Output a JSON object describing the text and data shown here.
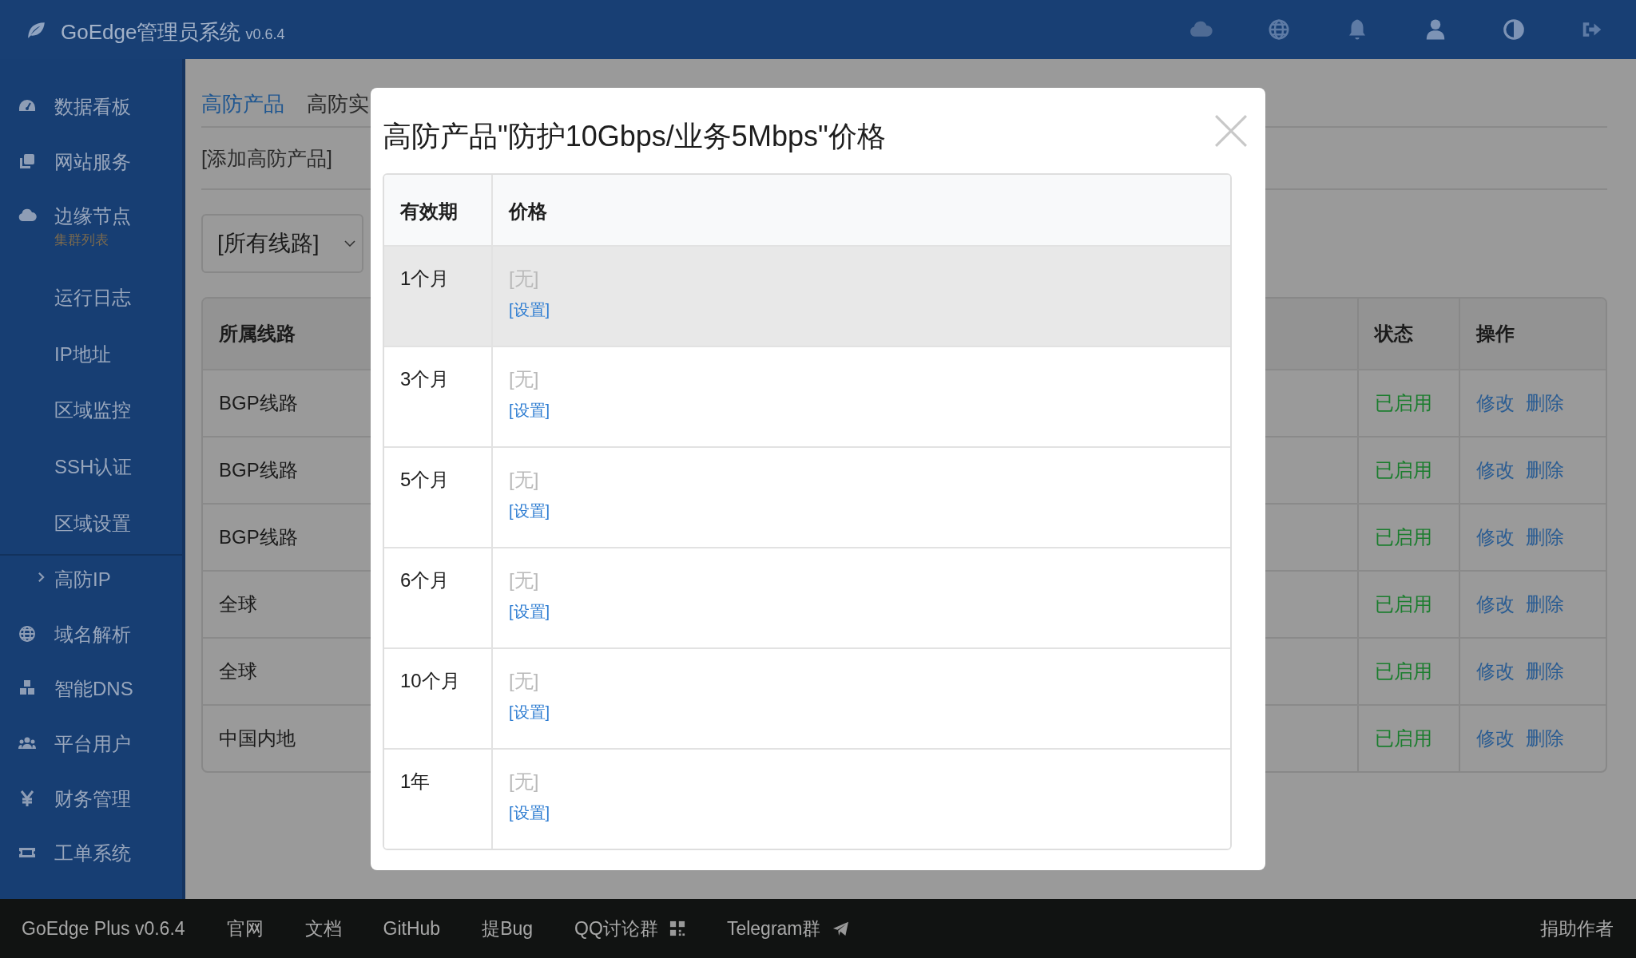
{
  "header": {
    "title": "GoEdge管理员系统",
    "version": "v0.6.4"
  },
  "sidebar": {
    "items": [
      {
        "kind": "main",
        "label": "数据看板"
      },
      {
        "kind": "main",
        "label": "网站服务"
      },
      {
        "kind": "main",
        "label": "边缘节点",
        "subtitle": "集群列表"
      },
      {
        "kind": "sub",
        "label": "运行日志"
      },
      {
        "kind": "sub",
        "label": "IP地址"
      },
      {
        "kind": "sub",
        "label": "区域监控"
      },
      {
        "kind": "sub",
        "label": "SSH认证"
      },
      {
        "kind": "sub",
        "label": "区域设置"
      },
      {
        "kind": "collapsible",
        "label": "高防IP"
      },
      {
        "kind": "main",
        "label": "域名解析"
      },
      {
        "kind": "main",
        "label": "智能DNS"
      },
      {
        "kind": "main",
        "label": "平台用户"
      },
      {
        "kind": "main",
        "label": "财务管理"
      },
      {
        "kind": "main",
        "label": "工单系统"
      }
    ]
  },
  "tabs": [
    {
      "label": "高防产品",
      "selected": true
    },
    {
      "label": "高防实",
      "selected": false
    }
  ],
  "add_link": "[添加高防产品]",
  "filter": {
    "value": "[所有线路]"
  },
  "table": {
    "columns": [
      "所属线路",
      "状态",
      "操作"
    ],
    "rows": [
      {
        "line": "BGP线路",
        "status": "已启用",
        "actions": [
          "修改",
          "删除"
        ]
      },
      {
        "line": "BGP线路",
        "status": "已启用",
        "actions": [
          "修改",
          "删除"
        ]
      },
      {
        "line": "BGP线路",
        "status": "已启用",
        "actions": [
          "修改",
          "删除"
        ]
      },
      {
        "line": "全球",
        "status": "已启用",
        "actions": [
          "修改",
          "删除"
        ]
      },
      {
        "line": "全球",
        "status": "已启用",
        "actions": [
          "修改",
          "删除"
        ]
      },
      {
        "line": "中国内地",
        "status": "已启用",
        "actions": [
          "修改",
          "删除"
        ]
      }
    ]
  },
  "modal": {
    "title": "高防产品\"防护10Gbps/业务5Mbps\"价格",
    "columns": [
      "有效期",
      "价格"
    ],
    "rows": [
      {
        "period": "1个月",
        "price": "[无]",
        "action": "[设置]",
        "hovered": true
      },
      {
        "period": "3个月",
        "price": "[无]",
        "action": "[设置]",
        "hovered": false
      },
      {
        "period": "5个月",
        "price": "[无]",
        "action": "[设置]",
        "hovered": false
      },
      {
        "period": "6个月",
        "price": "[无]",
        "action": "[设置]",
        "hovered": false
      },
      {
        "period": "10个月",
        "price": "[无]",
        "action": "[设置]",
        "hovered": false
      },
      {
        "period": "1年",
        "price": "[无]",
        "action": "[设置]",
        "hovered": false
      }
    ]
  },
  "footer": {
    "items": [
      {
        "label": "GoEdge Plus v0.6.4",
        "has_icon": false
      },
      {
        "label": "官网",
        "has_icon": false
      },
      {
        "label": "文档",
        "has_icon": false
      },
      {
        "label": "GitHub",
        "has_icon": false
      },
      {
        "label": "提Bug",
        "has_icon": false
      },
      {
        "label": "QQ讨论群",
        "has_icon": true
      },
      {
        "label": "Telegram群",
        "has_icon": true
      }
    ],
    "right": "捐助作者"
  }
}
